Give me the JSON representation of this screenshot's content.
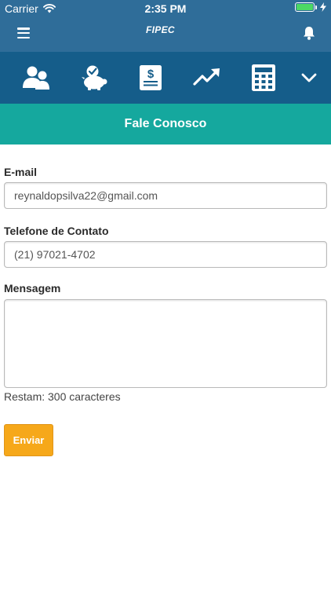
{
  "status_bar": {
    "carrier": "Carrier",
    "time": "2:35 PM"
  },
  "app_bar": {
    "logo_text": "FIPEC"
  },
  "icon_nav": {
    "items": [
      {
        "icon": "users-icon"
      },
      {
        "icon": "piggy-bank-icon"
      },
      {
        "icon": "document-dollar-icon"
      },
      {
        "icon": "trending-up-icon"
      },
      {
        "icon": "calculator-icon"
      },
      {
        "icon": "chevron-down-icon"
      }
    ]
  },
  "page": {
    "title": "Fale Conosco"
  },
  "form": {
    "email_label": "E-mail",
    "email_value": "reynaldopsilva22@gmail.com",
    "phone_label": "Telefone de Contato",
    "phone_value": "(21) 97021-4702",
    "message_label": "Mensagem",
    "message_value": "",
    "counter_text": "Restam: 300 caracteres",
    "submit_label": "Enviar"
  },
  "colors": {
    "app_bar": "#2f6d99",
    "icon_nav": "#155d8a",
    "section_header": "#15a89e",
    "submit_button": "#f6a81a",
    "battery": "#4cd964"
  }
}
